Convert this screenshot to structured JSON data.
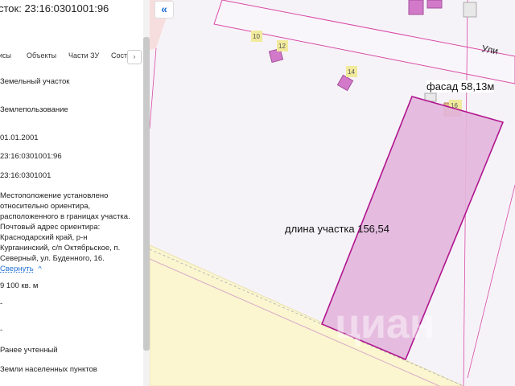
{
  "panel": {
    "title": "сток: 23:16:0301001:96",
    "tabs": [
      "исы",
      "Объекты",
      "Части ЗУ",
      "Соста"
    ],
    "tab_next": "›",
    "rows": [
      "Земельный участок",
      "Землепользование",
      "01.01.2001",
      "23:16:0301001:96",
      "23:16:0301001"
    ],
    "address_lines": [
      "Местоположение установлено",
      "относительно ориентира,",
      "расположенного в границах участка.",
      "Почтовый адрес ориентира:",
      "Краснодарский край, р-н",
      "Курганинский, с/п Октябрьское, п.",
      "Северный, ул. Буденного, 16."
    ],
    "collapse_label": "Свернуть",
    "collapse_icon": "^",
    "area": "9 100 кв. м",
    "dash1": "-",
    "dash2": "-",
    "status": "Ранее учтенный",
    "category": "Земли населенных пунктов"
  },
  "map": {
    "back_button": "«",
    "street_label": "Ули",
    "facade_label": "фасад 58,13м",
    "length_label": "длина участка 156,54",
    "house_numbers": [
      "10",
      "12",
      "14",
      "16"
    ],
    "watermark": "циан"
  },
  "colors": {
    "parcel_fill": "#e3b6dc",
    "parcel_stroke": "#b0158f",
    "field_fill": "#fbf6cf",
    "road_line": "#d94aa6",
    "link": "#1f6fd1"
  }
}
